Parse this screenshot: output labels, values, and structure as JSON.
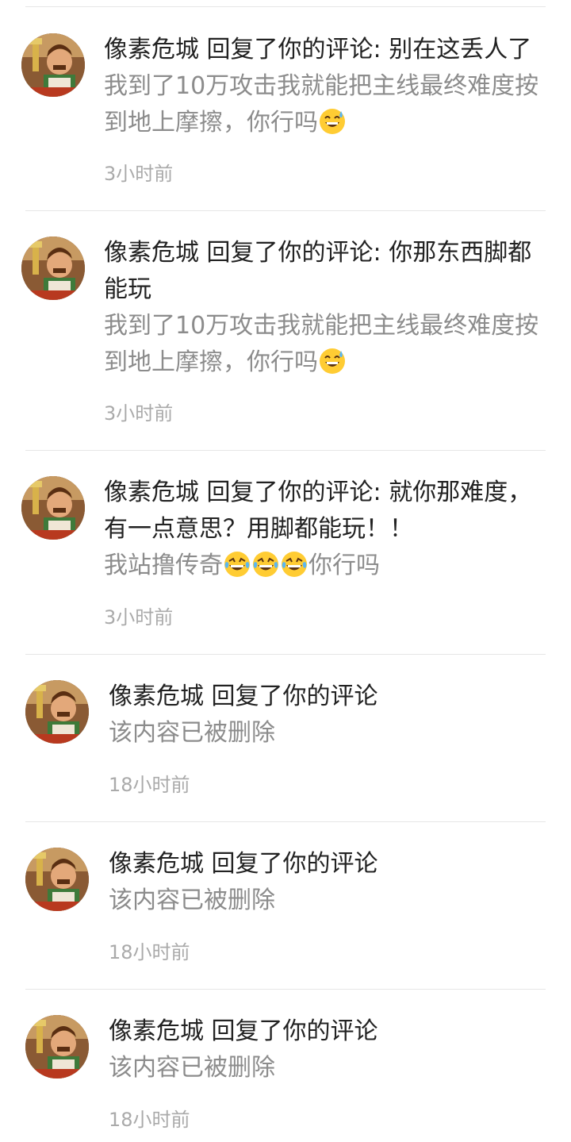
{
  "notifications": [
    {
      "user": "像素危城",
      "action": "回复了你的评论",
      "reply": ": 别在这丢人了",
      "snippet_text": "我到了10万攻击我就能把主线最终难度按到地上摩擦，你行吗",
      "snippet_emojis": [
        "sweat-smile"
      ],
      "time": "3小时前"
    },
    {
      "user": "像素危城",
      "action": "回复了你的评论",
      "reply": ": 你那东西脚都能玩",
      "snippet_text": "我到了10万攻击我就能把主线最终难度按到地上摩擦，你行吗",
      "snippet_emojis": [
        "sweat-smile"
      ],
      "time": "3小时前"
    },
    {
      "user": "像素危城",
      "action": "回复了你的评论",
      "reply": ": 就你那难度，有一点意思？用脚都能玩！！",
      "snippet_text_before": "我站撸传奇",
      "snippet_emojis": [
        "tears-of-joy",
        "tears-of-joy",
        "tears-of-joy"
      ],
      "snippet_text_after": "你行吗",
      "time": "3小时前"
    },
    {
      "user": "像素危城",
      "action": "回复了你的评论",
      "snippet_text": "该内容已被删除",
      "time": "18小时前"
    },
    {
      "user": "像素危城",
      "action": "回复了你的评论",
      "snippet_text": "该内容已被删除",
      "time": "18小时前"
    },
    {
      "user": "像素危城",
      "action": "回复了你的评论",
      "snippet_text": "该内容已被删除",
      "time": "18小时前"
    }
  ],
  "colors": {
    "primary_text": "#222222",
    "secondary_text": "#8c8c8c",
    "time_text": "#aaaaaa",
    "divider": "#e6e6e6"
  }
}
